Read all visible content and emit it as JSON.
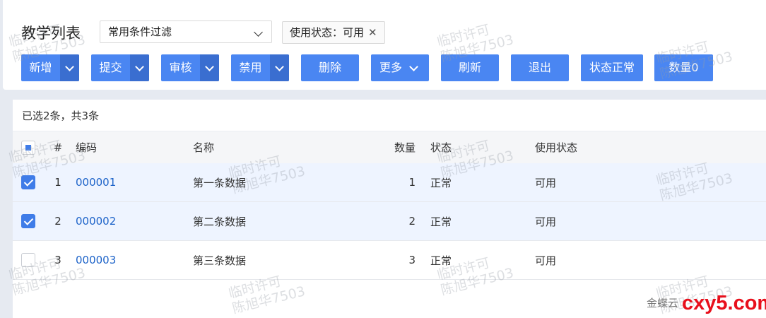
{
  "page_title": "教学列表",
  "filter": {
    "selected": "常用条件过滤"
  },
  "filter_tag": {
    "label": "使用状态：可用",
    "close": "✕"
  },
  "toolbar": {
    "add": "新增",
    "submit": "提交",
    "audit": "审核",
    "disable": "禁用",
    "delete": "删除",
    "more": "更多",
    "refresh": "刷新",
    "exit": "退出",
    "status_normal": "状态正常",
    "qty_zero": "数量0"
  },
  "selection_info": "已选2条，共3条",
  "table": {
    "headers": {
      "index": "#",
      "code": "编码",
      "name": "名称",
      "qty": "数量",
      "status": "状态",
      "use_status": "使用状态"
    },
    "rows": [
      {
        "index": "1",
        "code": "000001",
        "name": "第一条数据",
        "qty": "1",
        "status": "正常",
        "use_status": "可用",
        "checked": true
      },
      {
        "index": "2",
        "code": "000002",
        "name": "第二条数据",
        "qty": "2",
        "status": "正常",
        "use_status": "可用",
        "checked": true
      },
      {
        "index": "3",
        "code": "000003",
        "name": "第三条数据",
        "qty": "3",
        "status": "正常",
        "use_status": "可用",
        "checked": false
      }
    ]
  },
  "watermark": {
    "line1": "临时许可",
    "line2": "陈旭华7503"
  },
  "footer": {
    "brand": "金蝶云",
    "logo": "cxy5.com"
  },
  "colors": {
    "primary": "#4a86f2",
    "primary_dark": "#3a6ed0",
    "link": "#1d63c9",
    "logo": "#e8101c"
  }
}
